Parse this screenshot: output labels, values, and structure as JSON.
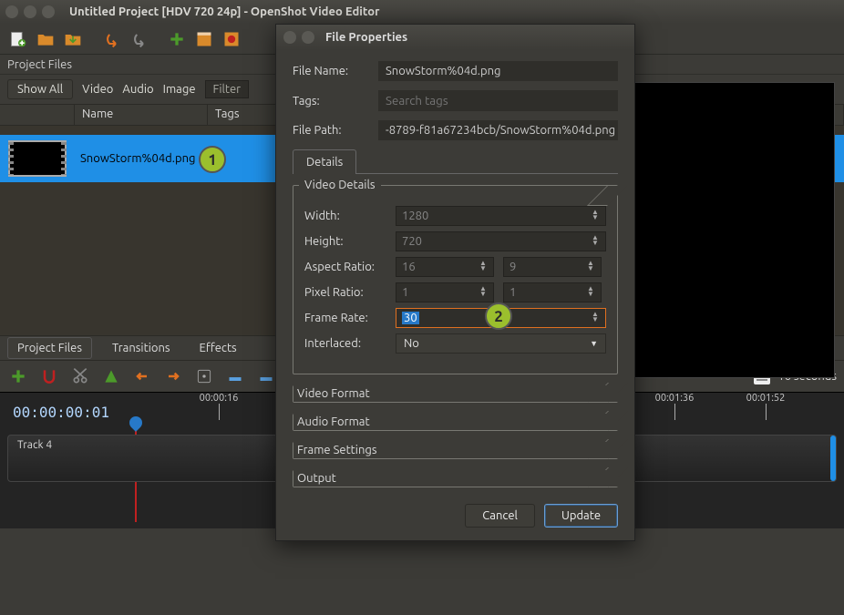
{
  "window": {
    "title": "Untitled Project [HDV 720 24p] - OpenShot Video Editor"
  },
  "project_panel": {
    "title": "Project Files",
    "toolbar": {
      "show_all": "Show All",
      "video": "Video",
      "audio": "Audio",
      "image": "Image",
      "filter_placeholder": "Filter"
    },
    "columns": {
      "name": "Name",
      "tags": "Tags"
    },
    "rows": [
      {
        "name": "SnowStorm%04d.png",
        "tags": ""
      }
    ]
  },
  "mid_tabs": {
    "project_files": "Project Files",
    "transitions": "Transitions",
    "effects": "Effects"
  },
  "timeline": {
    "duration_label": "16 seconds",
    "timecode": "00:00:00:01",
    "ticks": [
      "00:00:16",
      "00:01:36",
      "00:01:52"
    ],
    "tracks": [
      {
        "label": "Track 4"
      }
    ]
  },
  "dialog": {
    "title": "File Properties",
    "fields": {
      "file_name_label": "File Name:",
      "file_name": "SnowStorm%04d.png",
      "tags_label": "Tags:",
      "tags_placeholder": "Search tags",
      "file_path_label": "File Path:",
      "file_path": "-8789-f81a67234bcb/SnowStorm%04d.png"
    },
    "tab": "Details",
    "video_details": {
      "heading": "Video Details",
      "width_label": "Width:",
      "width": "1280",
      "height_label": "Height:",
      "height": "720",
      "aspect_label": "Aspect Ratio:",
      "aspect_a": "16",
      "aspect_b": "9",
      "pixel_label": "Pixel Ratio:",
      "pixel_a": "1",
      "pixel_b": "1",
      "framerate_label": "Frame Rate:",
      "framerate": "30",
      "interlaced_label": "Interlaced:",
      "interlaced_value": "No"
    },
    "sections": {
      "video_format": "Video Format",
      "audio_format": "Audio Format",
      "frame_settings": "Frame Settings",
      "output": "Output"
    },
    "buttons": {
      "cancel": "Cancel",
      "update": "Update"
    }
  },
  "callouts": {
    "one": "1",
    "two": "2"
  }
}
